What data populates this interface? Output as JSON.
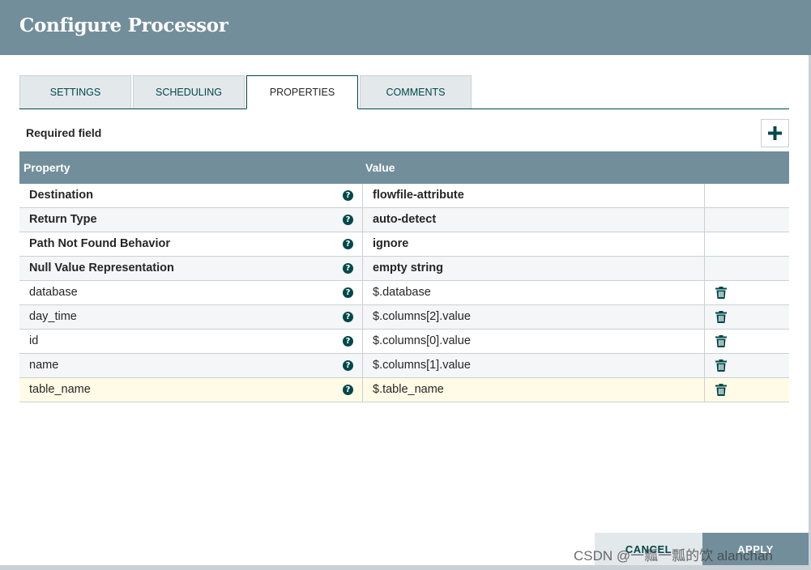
{
  "dialog": {
    "title": "Configure Processor"
  },
  "tabs": [
    {
      "label": "SETTINGS",
      "active": false
    },
    {
      "label": "SCHEDULING",
      "active": false
    },
    {
      "label": "PROPERTIES",
      "active": true
    },
    {
      "label": "COMMENTS",
      "active": false
    }
  ],
  "required_label": "Required field",
  "add_icon": "plus-icon",
  "table": {
    "columns": [
      "Property",
      "Value"
    ],
    "rows": [
      {
        "name": "Destination",
        "value": "flowfile-attribute",
        "required": true,
        "deletable": false
      },
      {
        "name": "Return Type",
        "value": "auto-detect",
        "required": true,
        "deletable": false
      },
      {
        "name": "Path Not Found Behavior",
        "value": "ignore",
        "required": true,
        "deletable": false
      },
      {
        "name": "Null Value Representation",
        "value": "empty string",
        "required": true,
        "deletable": false
      },
      {
        "name": "database",
        "value": "$.database",
        "required": false,
        "deletable": true
      },
      {
        "name": "day_time",
        "value": "$.columns[2].value",
        "required": false,
        "deletable": true
      },
      {
        "name": "id",
        "value": "$.columns[0].value",
        "required": false,
        "deletable": true
      },
      {
        "name": "name",
        "value": "$.columns[1].value",
        "required": false,
        "deletable": true
      },
      {
        "name": "table_name",
        "value": "$.table_name",
        "required": false,
        "deletable": true,
        "selected": true
      }
    ],
    "help_icon": "help-icon",
    "delete_icon": "trash-icon"
  },
  "buttons": {
    "cancel": "CANCEL",
    "apply": "APPLY"
  },
  "watermark": "CSDN @一瓢一瓢的饮 alanchan",
  "colors": {
    "header": "#728e9b",
    "accent": "#004849",
    "row_alt": "#f4f6f7",
    "row_selected": "#fffbe6"
  }
}
